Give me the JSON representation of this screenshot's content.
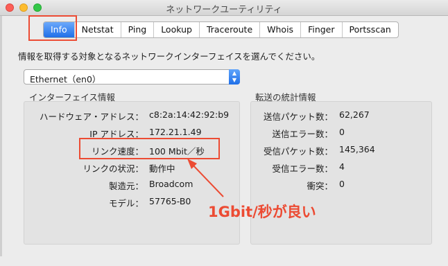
{
  "window": {
    "title": "ネットワークユーティリティ"
  },
  "tabs": [
    "Info",
    "Netstat",
    "Ping",
    "Lookup",
    "Traceroute",
    "Whois",
    "Finger",
    "Portsscan"
  ],
  "description": "情報を取得する対象となるネットワークインターフェイスを選んでください。",
  "interface_select": {
    "value": "Ethernet（en0）"
  },
  "interface_info": {
    "title": "インターフェイス情報",
    "rows": [
      {
        "label": "ハードウェア・アドレス：",
        "value": "c8:2a:14:42:92:b9"
      },
      {
        "label": "IP アドレス：",
        "value": "172.21.1.49"
      },
      {
        "label": "リンク速度：",
        "value": "100 Mbit／秒"
      },
      {
        "label": "リンクの状況：",
        "value": "動作中"
      },
      {
        "label": "製造元：",
        "value": "Broadcom"
      },
      {
        "label": "モデル：",
        "value": "57765-B0"
      }
    ]
  },
  "transfer_stats": {
    "title": "転送の統計情報",
    "rows": [
      {
        "label": "送信パケット数：",
        "value": "62,267"
      },
      {
        "label": "送信エラー数：",
        "value": "0"
      },
      {
        "label": "受信パケット数：",
        "value": "145,364"
      },
      {
        "label": "受信エラー数：",
        "value": "4"
      },
      {
        "label": "衝突：",
        "value": "0"
      }
    ]
  },
  "annotation": {
    "text": "1Gbit/秒が良い",
    "color": "#ec4b33"
  },
  "colors": {
    "accent": "#1f6fe8",
    "annotation": "#ec4b33"
  }
}
